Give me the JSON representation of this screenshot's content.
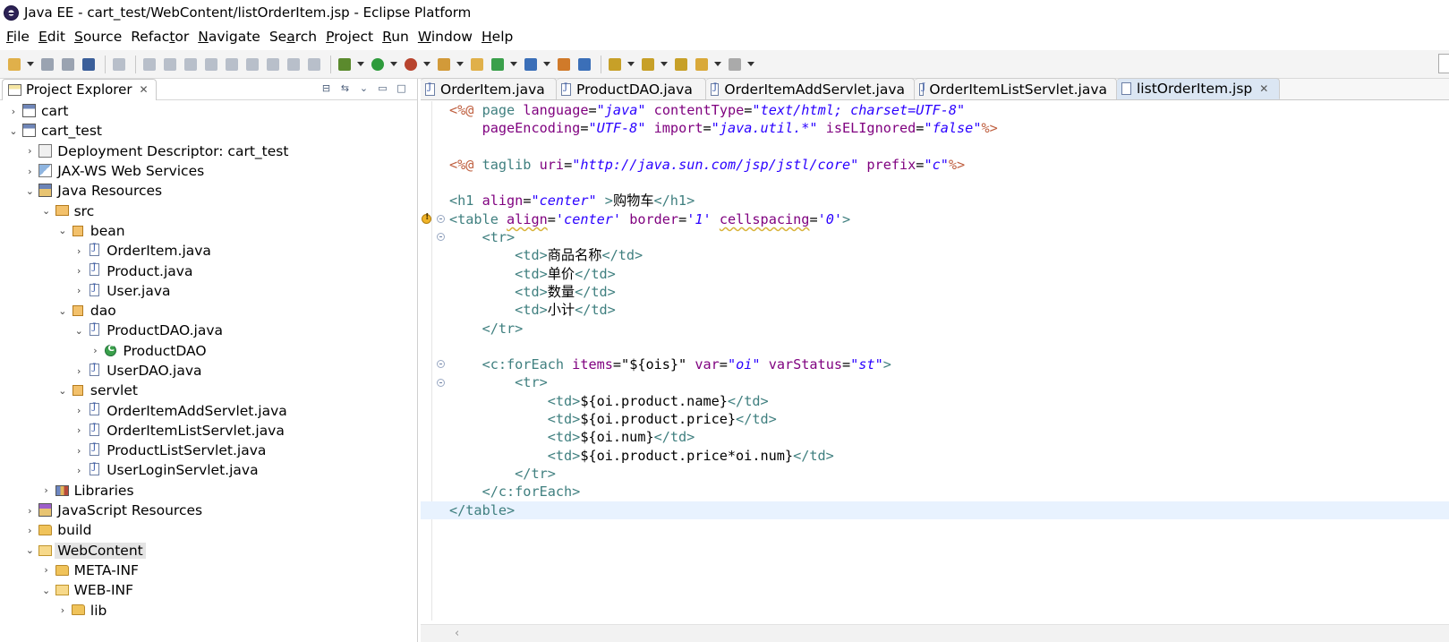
{
  "window": {
    "title": "Java EE - cart_test/WebContent/listOrderItem.jsp - Eclipse Platform"
  },
  "menu": [
    {
      "mn": "F",
      "rest": "ile"
    },
    {
      "mn": "E",
      "rest": "dit"
    },
    {
      "mn": "S",
      "rest": "ource"
    },
    {
      "pre": "Refac",
      "mn": "t",
      "rest": "or"
    },
    {
      "mn": "N",
      "rest": "avigate"
    },
    {
      "pre": "Se",
      "mn": "a",
      "rest": "rch"
    },
    {
      "mn": "P",
      "rest": "roject"
    },
    {
      "mn": "R",
      "rest": "un"
    },
    {
      "mn": "W",
      "rest": "indow"
    },
    {
      "mn": "H",
      "rest": "elp"
    }
  ],
  "toolbar": {
    "icons": [
      "new-icon",
      "save-icon",
      "save-all-icon",
      "open-console-icon",
      "skip-breakpoints-icon",
      "resume-icon",
      "suspend-icon",
      "terminate-icon",
      "disconnect-icon",
      "step-into-icon",
      "step-over-icon",
      "step-return-icon",
      "use-step-filters-icon",
      "toggle-mark-occurrences-icon",
      "debug-icon",
      "run-icon",
      "coverage-icon",
      "new-java-project-icon",
      "new-package-icon",
      "new-class-icon",
      "open-type-icon",
      "search-icon",
      "web-browser-icon",
      "next-annotation-icon",
      "prev-annotation-icon",
      "last-edit-location-icon",
      "back-icon",
      "forward-icon"
    ],
    "colors": {
      "run": "#2e9b3c",
      "debug": "#4a7a2a",
      "accent": "#3b6fb8"
    }
  },
  "project_explorer": {
    "title": "Project Explorer",
    "tree": [
      {
        "label": "cart",
        "depth": 0,
        "expanded": false,
        "icon": "project-icon",
        "ic": "project"
      },
      {
        "label": "cart_test",
        "depth": 0,
        "expanded": true,
        "icon": "project-icon",
        "ic": "project"
      },
      {
        "label": "Deployment Descriptor: cart_test",
        "depth": 1,
        "expanded": false,
        "icon": "deployment-descriptor-icon",
        "ic": "dd"
      },
      {
        "label": "JAX-WS Web Services",
        "depth": 1,
        "expanded": false,
        "icon": "web-services-icon",
        "ic": "ws"
      },
      {
        "label": "Java Resources",
        "depth": 1,
        "expanded": true,
        "icon": "java-resources-icon",
        "ic": "jres"
      },
      {
        "label": "src",
        "depth": 2,
        "expanded": true,
        "icon": "source-folder-icon",
        "ic": "src"
      },
      {
        "label": "bean",
        "depth": 3,
        "expanded": true,
        "icon": "package-icon",
        "ic": "package"
      },
      {
        "label": "OrderItem.java",
        "depth": 4,
        "expanded": false,
        "icon": "java-file-icon",
        "ic": "java"
      },
      {
        "label": "Product.java",
        "depth": 4,
        "expanded": false,
        "icon": "java-file-icon",
        "ic": "java"
      },
      {
        "label": "User.java",
        "depth": 4,
        "expanded": false,
        "icon": "java-file-icon",
        "ic": "java"
      },
      {
        "label": "dao",
        "depth": 3,
        "expanded": true,
        "icon": "package-icon",
        "ic": "package"
      },
      {
        "label": "ProductDAO.java",
        "depth": 4,
        "expanded": true,
        "icon": "java-file-icon",
        "ic": "java"
      },
      {
        "label": "ProductDAO",
        "depth": 5,
        "expanded": false,
        "icon": "class-icon",
        "ic": "class"
      },
      {
        "label": "UserDAO.java",
        "depth": 4,
        "expanded": false,
        "icon": "java-file-icon",
        "ic": "java"
      },
      {
        "label": "servlet",
        "depth": 3,
        "expanded": true,
        "icon": "package-icon",
        "ic": "package"
      },
      {
        "label": "OrderItemAddServlet.java",
        "depth": 4,
        "expanded": false,
        "icon": "java-file-icon",
        "ic": "java"
      },
      {
        "label": "OrderItemListServlet.java",
        "depth": 4,
        "expanded": false,
        "icon": "java-file-icon",
        "ic": "java"
      },
      {
        "label": "ProductListServlet.java",
        "depth": 4,
        "expanded": false,
        "icon": "java-file-icon",
        "ic": "java"
      },
      {
        "label": "UserLoginServlet.java",
        "depth": 4,
        "expanded": false,
        "icon": "java-file-icon",
        "ic": "java"
      },
      {
        "label": "Libraries",
        "depth": 2,
        "expanded": false,
        "icon": "libraries-icon",
        "ic": "lib"
      },
      {
        "label": "JavaScript Resources",
        "depth": 1,
        "expanded": false,
        "icon": "javascript-resources-icon",
        "ic": "jsres"
      },
      {
        "label": "build",
        "depth": 1,
        "expanded": false,
        "icon": "folder-icon",
        "ic": "folder"
      },
      {
        "label": "WebContent",
        "depth": 1,
        "expanded": true,
        "icon": "folder-open-icon",
        "ic": "folder-open",
        "selected": true
      },
      {
        "label": "META-INF",
        "depth": 2,
        "expanded": false,
        "icon": "folder-icon",
        "ic": "folder"
      },
      {
        "label": "WEB-INF",
        "depth": 2,
        "expanded": true,
        "icon": "folder-open-icon",
        "ic": "folder-open"
      },
      {
        "label": "lib",
        "depth": 3,
        "expanded": false,
        "icon": "folder-icon",
        "ic": "folder"
      }
    ]
  },
  "editor": {
    "tabs": [
      {
        "label": "OrderItem.java",
        "active": false
      },
      {
        "label": "ProductDAO.java",
        "active": false
      },
      {
        "label": "OrderItemAddServlet.java",
        "active": false
      },
      {
        "label": "OrderItemListServlet.java",
        "active": false
      },
      {
        "label": "listOrderItem.jsp",
        "active": true
      }
    ],
    "lines": [
      [
        [
          "jspd",
          "<%@"
        ],
        [
          "t",
          " "
        ],
        [
          "tag",
          "page"
        ],
        [
          "t",
          " "
        ],
        [
          "attr",
          "language"
        ],
        [
          "t",
          "="
        ],
        [
          "val",
          "\"java\""
        ],
        [
          "t",
          " "
        ],
        [
          "attr",
          "contentType"
        ],
        [
          "t",
          "="
        ],
        [
          "val",
          "\"text/html; charset=UTF-8\""
        ]
      ],
      [
        [
          "t",
          "    "
        ],
        [
          "attr",
          "pageEncoding"
        ],
        [
          "t",
          "="
        ],
        [
          "val",
          "\"UTF-8\""
        ],
        [
          "t",
          " "
        ],
        [
          "attr",
          "import"
        ],
        [
          "t",
          "="
        ],
        [
          "val",
          "\"java.util.*\""
        ],
        [
          "t",
          " "
        ],
        [
          "attr",
          "isELIgnored"
        ],
        [
          "t",
          "="
        ],
        [
          "val",
          "\"false\""
        ],
        [
          "jspd",
          "%>"
        ]
      ],
      [],
      [
        [
          "jspd",
          "<%@"
        ],
        [
          "t",
          " "
        ],
        [
          "tag",
          "taglib"
        ],
        [
          "t",
          " "
        ],
        [
          "attr",
          "uri"
        ],
        [
          "t",
          "="
        ],
        [
          "val",
          "\"http://java.sun.com/jsp/jstl/core\""
        ],
        [
          "t",
          " "
        ],
        [
          "attr",
          "prefix"
        ],
        [
          "t",
          "="
        ],
        [
          "val",
          "\"c\""
        ],
        [
          "jspd",
          "%>"
        ]
      ],
      [],
      [
        [
          "tag",
          "<h1"
        ],
        [
          "t",
          " "
        ],
        [
          "attr",
          "align"
        ],
        [
          "t",
          "="
        ],
        [
          "val",
          "\"center\""
        ],
        [
          "t",
          " "
        ],
        [
          "tag",
          ">"
        ],
        [
          "t",
          "购物车"
        ],
        [
          "tag",
          "</h1>"
        ]
      ],
      [
        [
          "tag",
          "<table"
        ],
        [
          "t",
          " "
        ],
        [
          "attrw",
          "align"
        ],
        [
          "t",
          "="
        ],
        [
          "val",
          "'center'"
        ],
        [
          "t",
          " "
        ],
        [
          "attr",
          "border"
        ],
        [
          "t",
          "="
        ],
        [
          "val",
          "'1'"
        ],
        [
          "t",
          " "
        ],
        [
          "attrw",
          "cellspacing"
        ],
        [
          "t",
          "="
        ],
        [
          "val",
          "'0'"
        ],
        [
          "tag",
          ">"
        ]
      ],
      [
        [
          "t",
          "    "
        ],
        [
          "tag",
          "<tr>"
        ]
      ],
      [
        [
          "t",
          "        "
        ],
        [
          "tag",
          "<td>"
        ],
        [
          "t",
          "商品名称"
        ],
        [
          "tag",
          "</td>"
        ]
      ],
      [
        [
          "t",
          "        "
        ],
        [
          "tag",
          "<td>"
        ],
        [
          "t",
          "单价"
        ],
        [
          "tag",
          "</td>"
        ]
      ],
      [
        [
          "t",
          "        "
        ],
        [
          "tag",
          "<td>"
        ],
        [
          "t",
          "数量"
        ],
        [
          "tag",
          "</td>"
        ]
      ],
      [
        [
          "t",
          "        "
        ],
        [
          "tag",
          "<td>"
        ],
        [
          "t",
          "小计"
        ],
        [
          "tag",
          "</td>"
        ]
      ],
      [
        [
          "t",
          "    "
        ],
        [
          "tag",
          "</tr>"
        ]
      ],
      [],
      [
        [
          "t",
          "    "
        ],
        [
          "tag",
          "<c:forEach"
        ],
        [
          "t",
          " "
        ],
        [
          "attr",
          "items"
        ],
        [
          "t",
          "="
        ],
        [
          "t",
          "\"${ois}\""
        ],
        [
          "t",
          " "
        ],
        [
          "attr",
          "var"
        ],
        [
          "t",
          "="
        ],
        [
          "val",
          "\"oi\""
        ],
        [
          "t",
          " "
        ],
        [
          "attr",
          "varStatus"
        ],
        [
          "t",
          "="
        ],
        [
          "val",
          "\"st\""
        ],
        [
          "tag",
          ">"
        ]
      ],
      [
        [
          "t",
          "        "
        ],
        [
          "tag",
          "<tr>"
        ]
      ],
      [
        [
          "t",
          "            "
        ],
        [
          "tag",
          "<td>"
        ],
        [
          "t",
          "${oi.product.name}"
        ],
        [
          "tag",
          "</td>"
        ]
      ],
      [
        [
          "t",
          "            "
        ],
        [
          "tag",
          "<td>"
        ],
        [
          "t",
          "${oi.product.price}"
        ],
        [
          "tag",
          "</td>"
        ]
      ],
      [
        [
          "t",
          "            "
        ],
        [
          "tag",
          "<td>"
        ],
        [
          "t",
          "${oi.num}"
        ],
        [
          "tag",
          "</td>"
        ]
      ],
      [
        [
          "t",
          "            "
        ],
        [
          "tag",
          "<td>"
        ],
        [
          "t",
          "${oi.product.price*oi.num}"
        ],
        [
          "tag",
          "</td>"
        ]
      ],
      [
        [
          "t",
          "        "
        ],
        [
          "tag",
          "</tr>"
        ]
      ],
      [
        [
          "t",
          "    "
        ],
        [
          "tag",
          "</c:forEach>"
        ]
      ],
      [
        [
          "tag",
          "</table>"
        ]
      ]
    ],
    "current_line": 23,
    "gutter": {
      "fold_lines": [
        7,
        8,
        15,
        16
      ],
      "warning_lines": [
        7
      ],
      "current_marker_line": 23
    }
  }
}
